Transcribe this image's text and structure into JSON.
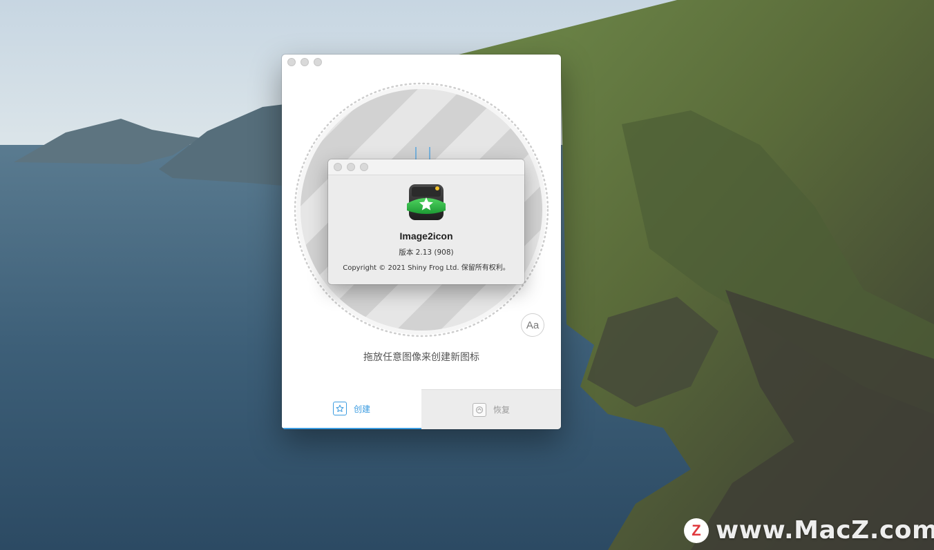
{
  "main_window": {
    "hint": "拖放任意图像来创建新图标",
    "font_button_label": "Aa",
    "tabs": [
      {
        "label": "创建",
        "icon": "star-icon",
        "active": true
      },
      {
        "label": "恢复",
        "icon": "restore-icon",
        "active": false
      }
    ]
  },
  "about": {
    "app_name": "Image2icon",
    "version": "版本 2.13 (908)",
    "copyright": "Copyright © 2021 Shiny Frog Ltd. 保留所有权利。"
  },
  "watermark": {
    "badge": "Z",
    "text": "www.MacZ.com"
  },
  "colors": {
    "accent": "#3a9be0",
    "window_bg": "#ffffff",
    "dialog_bg": "#ececec",
    "icon_green": "#2db84a"
  }
}
